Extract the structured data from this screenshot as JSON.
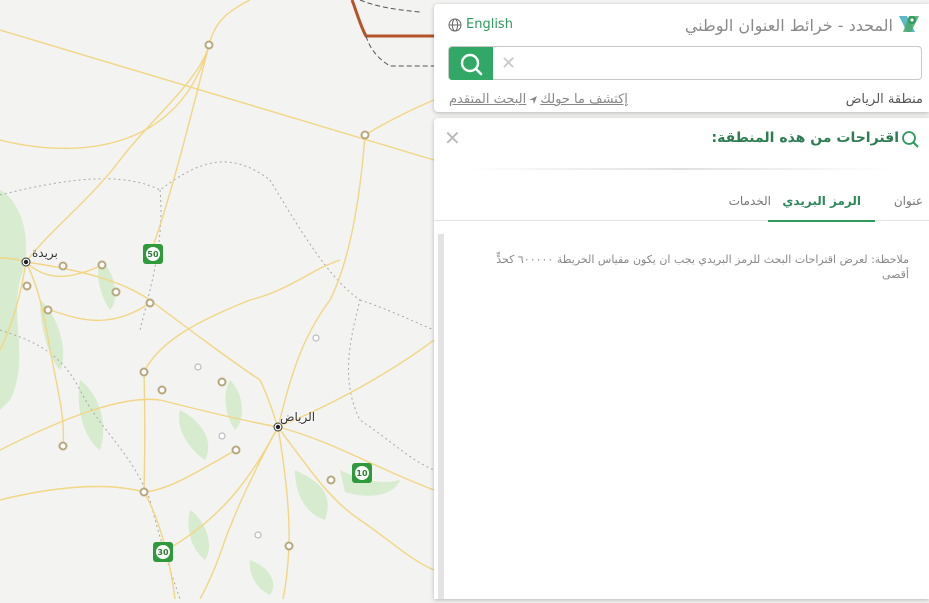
{
  "app": {
    "title": "المحدد - خرائط العنوان الوطني",
    "language_link": "English"
  },
  "search": {
    "value": "",
    "placeholder": ""
  },
  "region_text": "منطقة الرياض",
  "links": {
    "explore": "إكتشف ما حولك",
    "advanced": "البحث المتقدم"
  },
  "suggestions": {
    "title": "اقتراحات من هذه المنطقة:",
    "tabs": [
      {
        "label": "عنوان",
        "active": false
      },
      {
        "label": "الرمز البريدي",
        "active": true
      },
      {
        "label": "الخدمات",
        "active": false
      }
    ],
    "note": "ملاحظة: لعرض اقتراحات البحث للرمز البريدي يجب ان يكون مقياس الخريطة ٦٠٠٠٠٠ كحدٍّ أقصى"
  },
  "map": {
    "city_labels": [
      "بريدة",
      "الرياض"
    ],
    "highway_shields": [
      "50",
      "10",
      "30"
    ],
    "colors": {
      "background": "#f3f3f1",
      "road": "#f5d985",
      "vegetation": "#cfe8c4",
      "boundary": "#9a9a9a",
      "highway_route": "#b5542a",
      "accent": "#32a866"
    }
  },
  "icons": {
    "logo": "location-pin-logo-icon",
    "language": "globe-icon",
    "search": "search-icon",
    "clear": "close-icon",
    "suggestions": "search-icon",
    "close_panel": "close-icon",
    "explore": "navigation-arrow-icon"
  }
}
